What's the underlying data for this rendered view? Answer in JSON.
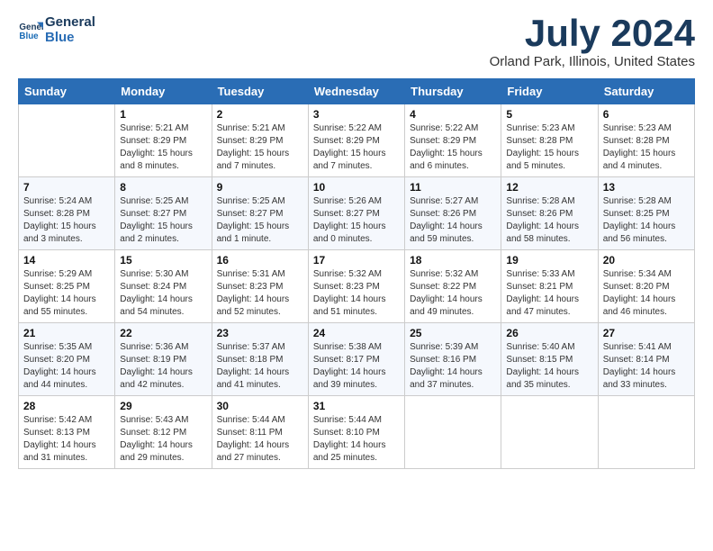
{
  "header": {
    "logo_line1": "General",
    "logo_line2": "Blue",
    "month": "July 2024",
    "location": "Orland Park, Illinois, United States"
  },
  "weekdays": [
    "Sunday",
    "Monday",
    "Tuesday",
    "Wednesday",
    "Thursday",
    "Friday",
    "Saturday"
  ],
  "weeks": [
    [
      {
        "day": "",
        "info": ""
      },
      {
        "day": "1",
        "info": "Sunrise: 5:21 AM\nSunset: 8:29 PM\nDaylight: 15 hours\nand 8 minutes."
      },
      {
        "day": "2",
        "info": "Sunrise: 5:21 AM\nSunset: 8:29 PM\nDaylight: 15 hours\nand 7 minutes."
      },
      {
        "day": "3",
        "info": "Sunrise: 5:22 AM\nSunset: 8:29 PM\nDaylight: 15 hours\nand 7 minutes."
      },
      {
        "day": "4",
        "info": "Sunrise: 5:22 AM\nSunset: 8:29 PM\nDaylight: 15 hours\nand 6 minutes."
      },
      {
        "day": "5",
        "info": "Sunrise: 5:23 AM\nSunset: 8:28 PM\nDaylight: 15 hours\nand 5 minutes."
      },
      {
        "day": "6",
        "info": "Sunrise: 5:23 AM\nSunset: 8:28 PM\nDaylight: 15 hours\nand 4 minutes."
      }
    ],
    [
      {
        "day": "7",
        "info": "Sunrise: 5:24 AM\nSunset: 8:28 PM\nDaylight: 15 hours\nand 3 minutes."
      },
      {
        "day": "8",
        "info": "Sunrise: 5:25 AM\nSunset: 8:27 PM\nDaylight: 15 hours\nand 2 minutes."
      },
      {
        "day": "9",
        "info": "Sunrise: 5:25 AM\nSunset: 8:27 PM\nDaylight: 15 hours\nand 1 minute."
      },
      {
        "day": "10",
        "info": "Sunrise: 5:26 AM\nSunset: 8:27 PM\nDaylight: 15 hours\nand 0 minutes."
      },
      {
        "day": "11",
        "info": "Sunrise: 5:27 AM\nSunset: 8:26 PM\nDaylight: 14 hours\nand 59 minutes."
      },
      {
        "day": "12",
        "info": "Sunrise: 5:28 AM\nSunset: 8:26 PM\nDaylight: 14 hours\nand 58 minutes."
      },
      {
        "day": "13",
        "info": "Sunrise: 5:28 AM\nSunset: 8:25 PM\nDaylight: 14 hours\nand 56 minutes."
      }
    ],
    [
      {
        "day": "14",
        "info": "Sunrise: 5:29 AM\nSunset: 8:25 PM\nDaylight: 14 hours\nand 55 minutes."
      },
      {
        "day": "15",
        "info": "Sunrise: 5:30 AM\nSunset: 8:24 PM\nDaylight: 14 hours\nand 54 minutes."
      },
      {
        "day": "16",
        "info": "Sunrise: 5:31 AM\nSunset: 8:23 PM\nDaylight: 14 hours\nand 52 minutes."
      },
      {
        "day": "17",
        "info": "Sunrise: 5:32 AM\nSunset: 8:23 PM\nDaylight: 14 hours\nand 51 minutes."
      },
      {
        "day": "18",
        "info": "Sunrise: 5:32 AM\nSunset: 8:22 PM\nDaylight: 14 hours\nand 49 minutes."
      },
      {
        "day": "19",
        "info": "Sunrise: 5:33 AM\nSunset: 8:21 PM\nDaylight: 14 hours\nand 47 minutes."
      },
      {
        "day": "20",
        "info": "Sunrise: 5:34 AM\nSunset: 8:20 PM\nDaylight: 14 hours\nand 46 minutes."
      }
    ],
    [
      {
        "day": "21",
        "info": "Sunrise: 5:35 AM\nSunset: 8:20 PM\nDaylight: 14 hours\nand 44 minutes."
      },
      {
        "day": "22",
        "info": "Sunrise: 5:36 AM\nSunset: 8:19 PM\nDaylight: 14 hours\nand 42 minutes."
      },
      {
        "day": "23",
        "info": "Sunrise: 5:37 AM\nSunset: 8:18 PM\nDaylight: 14 hours\nand 41 minutes."
      },
      {
        "day": "24",
        "info": "Sunrise: 5:38 AM\nSunset: 8:17 PM\nDaylight: 14 hours\nand 39 minutes."
      },
      {
        "day": "25",
        "info": "Sunrise: 5:39 AM\nSunset: 8:16 PM\nDaylight: 14 hours\nand 37 minutes."
      },
      {
        "day": "26",
        "info": "Sunrise: 5:40 AM\nSunset: 8:15 PM\nDaylight: 14 hours\nand 35 minutes."
      },
      {
        "day": "27",
        "info": "Sunrise: 5:41 AM\nSunset: 8:14 PM\nDaylight: 14 hours\nand 33 minutes."
      }
    ],
    [
      {
        "day": "28",
        "info": "Sunrise: 5:42 AM\nSunset: 8:13 PM\nDaylight: 14 hours\nand 31 minutes."
      },
      {
        "day": "29",
        "info": "Sunrise: 5:43 AM\nSunset: 8:12 PM\nDaylight: 14 hours\nand 29 minutes."
      },
      {
        "day": "30",
        "info": "Sunrise: 5:44 AM\nSunset: 8:11 PM\nDaylight: 14 hours\nand 27 minutes."
      },
      {
        "day": "31",
        "info": "Sunrise: 5:44 AM\nSunset: 8:10 PM\nDaylight: 14 hours\nand 25 minutes."
      },
      {
        "day": "",
        "info": ""
      },
      {
        "day": "",
        "info": ""
      },
      {
        "day": "",
        "info": ""
      }
    ]
  ]
}
